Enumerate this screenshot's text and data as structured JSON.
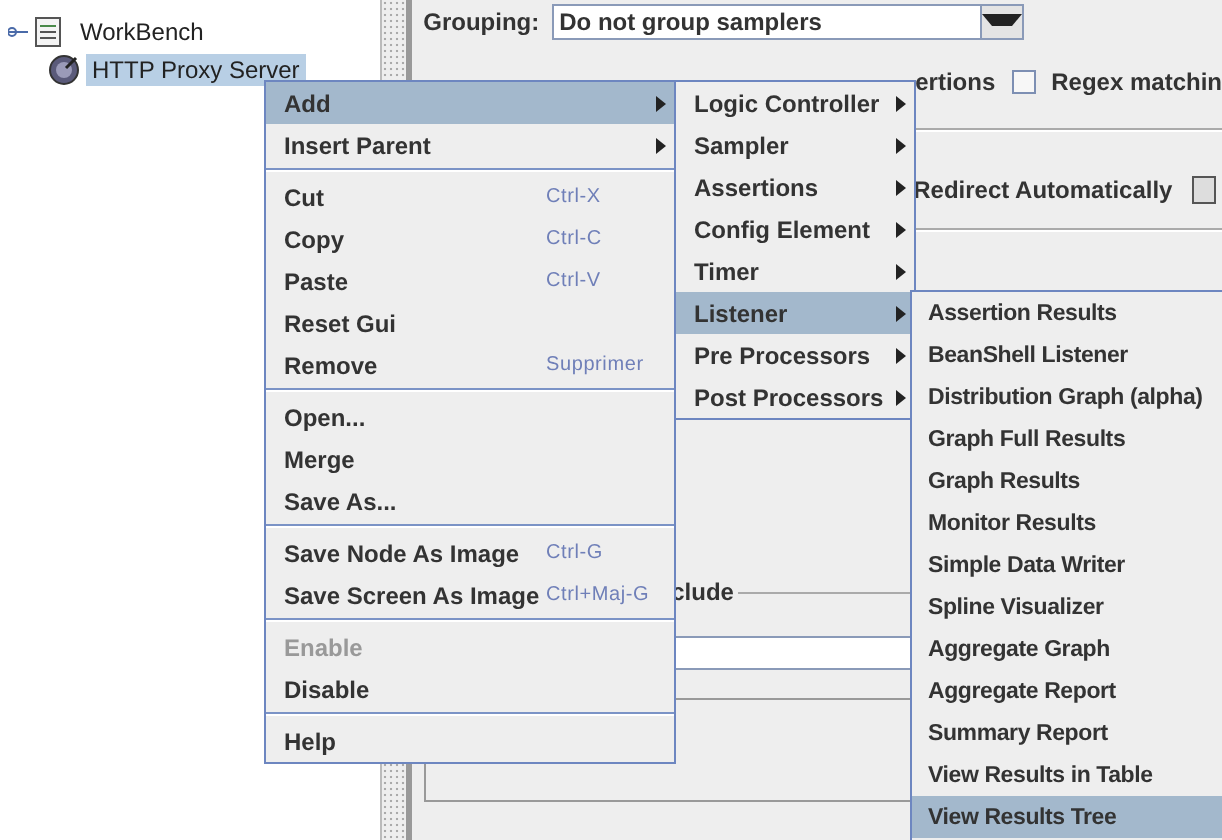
{
  "tree": {
    "items": [
      {
        "label": "WorkBench",
        "selected": false,
        "children": [
          {
            "label": "HTTP Proxy Server",
            "selected": true
          }
        ]
      }
    ]
  },
  "panel": {
    "grouping_label": "Grouping:",
    "grouping_value": "Do not group samplers",
    "partial_label": "ertions",
    "regex_checkbox": {
      "label": "Regex matchin",
      "checked": false
    },
    "redirect_label": "Redirect Automatically",
    "include_label": "clude"
  },
  "context_menu": {
    "items": [
      {
        "kind": "item",
        "label": "Add",
        "selected": true,
        "disabled": false,
        "submenu": true
      },
      {
        "kind": "item",
        "label": "Insert Parent",
        "selected": false,
        "disabled": false,
        "submenu": true
      },
      {
        "kind": "separator"
      },
      {
        "kind": "item",
        "label": "Cut",
        "shortcut": "Ctrl-X",
        "selected": false,
        "disabled": false,
        "submenu": false
      },
      {
        "kind": "item",
        "label": "Copy",
        "shortcut": "Ctrl-C",
        "selected": false,
        "disabled": false,
        "submenu": false
      },
      {
        "kind": "item",
        "label": "Paste",
        "shortcut": "Ctrl-V",
        "selected": false,
        "disabled": false,
        "submenu": false
      },
      {
        "kind": "item",
        "label": "Reset Gui",
        "selected": false,
        "disabled": false,
        "submenu": false
      },
      {
        "kind": "item",
        "label": "Remove",
        "shortcut": "Supprimer",
        "selected": false,
        "disabled": false,
        "submenu": false
      },
      {
        "kind": "separator"
      },
      {
        "kind": "item",
        "label": "Open...",
        "selected": false,
        "disabled": false,
        "submenu": false
      },
      {
        "kind": "item",
        "label": "Merge",
        "selected": false,
        "disabled": false,
        "submenu": false
      },
      {
        "kind": "item",
        "label": "Save As...",
        "selected": false,
        "disabled": false,
        "submenu": false
      },
      {
        "kind": "separator"
      },
      {
        "kind": "item",
        "label": "Save Node As Image",
        "shortcut": "Ctrl-G",
        "selected": false,
        "disabled": false,
        "submenu": false
      },
      {
        "kind": "item",
        "label": "Save Screen As Image",
        "shortcut": "Ctrl+Maj-G",
        "selected": false,
        "disabled": false,
        "submenu": false
      },
      {
        "kind": "separator"
      },
      {
        "kind": "item",
        "label": "Enable",
        "selected": false,
        "disabled": true,
        "submenu": false
      },
      {
        "kind": "item",
        "label": "Disable",
        "selected": false,
        "disabled": false,
        "submenu": false
      },
      {
        "kind": "separator"
      },
      {
        "kind": "item",
        "label": "Help",
        "selected": false,
        "disabled": false,
        "submenu": false
      }
    ]
  },
  "add_submenu": {
    "items": [
      {
        "kind": "item",
        "label": "Logic Controller",
        "selected": false,
        "disabled": false,
        "submenu": true
      },
      {
        "kind": "item",
        "label": "Sampler",
        "selected": false,
        "disabled": false,
        "submenu": true
      },
      {
        "kind": "item",
        "label": "Assertions",
        "selected": false,
        "disabled": false,
        "submenu": true
      },
      {
        "kind": "item",
        "label": "Config Element",
        "selected": false,
        "disabled": false,
        "submenu": true
      },
      {
        "kind": "item",
        "label": "Timer",
        "selected": false,
        "disabled": false,
        "submenu": true
      },
      {
        "kind": "item",
        "label": "Listener",
        "selected": true,
        "disabled": false,
        "submenu": true
      },
      {
        "kind": "item",
        "label": "Pre Processors",
        "selected": false,
        "disabled": false,
        "submenu": true
      },
      {
        "kind": "item",
        "label": "Post Processors",
        "selected": false,
        "disabled": false,
        "submenu": true
      }
    ]
  },
  "listener_submenu": {
    "items": [
      {
        "kind": "item",
        "label": "Assertion Results",
        "selected": false,
        "disabled": false
      },
      {
        "kind": "item",
        "label": "BeanShell Listener",
        "selected": false,
        "disabled": false
      },
      {
        "kind": "item",
        "label": "Distribution Graph (alpha)",
        "selected": false,
        "disabled": false
      },
      {
        "kind": "item",
        "label": "Graph Full Results",
        "selected": false,
        "disabled": false
      },
      {
        "kind": "item",
        "label": "Graph Results",
        "selected": false,
        "disabled": false
      },
      {
        "kind": "item",
        "label": "Monitor Results",
        "selected": false,
        "disabled": false
      },
      {
        "kind": "item",
        "label": "Simple Data Writer",
        "selected": false,
        "disabled": false
      },
      {
        "kind": "item",
        "label": "Spline Visualizer",
        "selected": false,
        "disabled": false
      },
      {
        "kind": "item",
        "label": "Aggregate Graph",
        "selected": false,
        "disabled": false
      },
      {
        "kind": "item",
        "label": "Aggregate Report",
        "selected": false,
        "disabled": false
      },
      {
        "kind": "item",
        "label": "Summary Report",
        "selected": false,
        "disabled": false
      },
      {
        "kind": "item",
        "label": "View Results in Table",
        "selected": false,
        "disabled": false
      },
      {
        "kind": "item",
        "label": "View Results Tree",
        "selected": true,
        "disabled": false
      }
    ]
  }
}
